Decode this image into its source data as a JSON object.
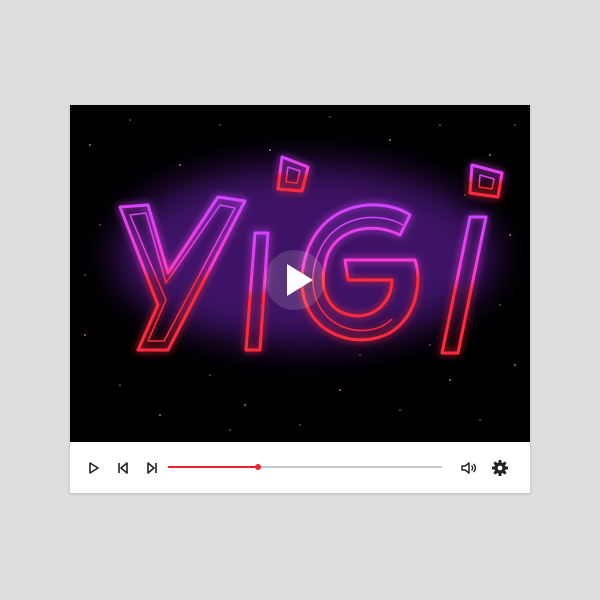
{
  "video": {
    "title_art": "YiGi",
    "neon_colors": {
      "violet": "#c23cff",
      "magenta": "#ff3ad8",
      "red": "#ff2a3c",
      "glow": "#8a2be2"
    }
  },
  "player": {
    "progress": 0.33,
    "accent_color": "#e8232d",
    "track_color": "#c9c9c9"
  },
  "icons": {
    "big_play": "play-icon",
    "play": "play-icon",
    "previous": "skip-previous-icon",
    "next": "skip-next-icon",
    "volume": "volume-icon",
    "settings": "gear-icon"
  }
}
